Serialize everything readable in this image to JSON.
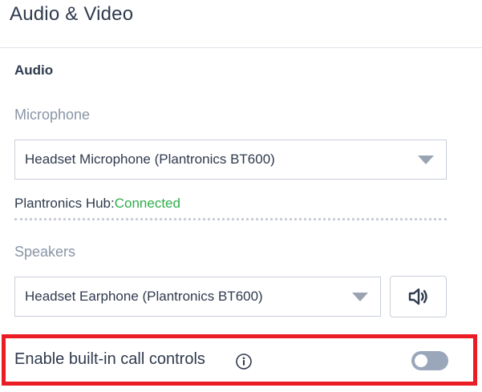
{
  "page": {
    "title": "Audio & Video"
  },
  "audio": {
    "heading": "Audio",
    "microphone": {
      "label": "Microphone",
      "selected": "Headset Microphone (Plantronics BT600)"
    },
    "hub": {
      "label": "Plantronics Hub:",
      "status": "Connected",
      "status_color": "#2dae4a"
    },
    "speakers": {
      "label": "Speakers",
      "selected": "Headset Earphone (Plantronics BT600)"
    },
    "call_controls": {
      "label": "Enable built-in call controls",
      "enabled": false
    }
  },
  "icons": {
    "dropdown": "chevron-down-icon",
    "speaker": "speaker-icon",
    "info": "info-icon"
  },
  "colors": {
    "highlight": "#ea1c24",
    "toggle_off": "#9aa6ba",
    "text": "#2f3a4d",
    "muted_label": "#8a95a6"
  }
}
